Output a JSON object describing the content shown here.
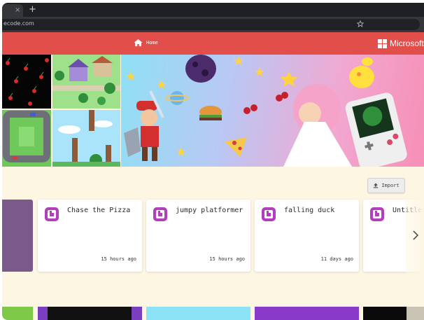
{
  "browser": {
    "tab_close_glyph": "×",
    "new_tab_glyph": "+",
    "url": "ecode.com",
    "bookmark_icon": "star-icon"
  },
  "appbar": {
    "background": "#e24f4a",
    "home_label": "Home",
    "home_icon": "home-icon",
    "brand": "Microsoft"
  },
  "hero": {
    "gradient": [
      "#c8cdf8",
      "#f3a3cc",
      "#f78fb6"
    ]
  },
  "projects": {
    "import_label": "Import",
    "items": [
      {
        "title": "Chase the Pizza",
        "time": "15 hours ago"
      },
      {
        "title": "jumpy platformer",
        "time": "15 hours ago"
      },
      {
        "title": "falling duck",
        "time": "11 days ago"
      },
      {
        "title": "Untitled",
        "time": ""
      }
    ],
    "scroll_icon": "chevron-right-icon"
  },
  "colors": {
    "page_bg": "#fdf6e3",
    "accent": "#e24f4a",
    "card_icon": "#b13fbd"
  }
}
